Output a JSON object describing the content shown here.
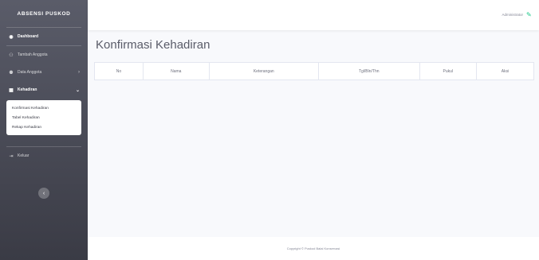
{
  "app": {
    "brand": "ABSENSI PUSKOD"
  },
  "sidebar": {
    "items": [
      {
        "label": "Dashboard",
        "icon": "tachometer-icon"
      },
      {
        "label": "Tambah Anggota",
        "icon": "user-plus-icon"
      },
      {
        "label": "Data Anggota",
        "icon": "users-icon"
      },
      {
        "label": "Kehadiran",
        "icon": "table-icon"
      },
      {
        "label": "Keluar",
        "icon": "sign-out-icon"
      }
    ],
    "submenu": [
      "Konfirmasi Kehadiran",
      "Tabel Kehadiran",
      "Rekap Kehadiran"
    ]
  },
  "topbar": {
    "user_name": "Administrator"
  },
  "main": {
    "title": "Konfirmasi Kehadiran",
    "table": {
      "columns": [
        "No",
        "Nama",
        "Keterangan",
        "Tgl/Bln/Thn",
        "Pukul",
        "Aksi"
      ],
      "rows": []
    }
  },
  "footer": {
    "text": "Copyright © Puskod Balai Konservasi"
  },
  "colors": {
    "sidebar_top": "#5a5c69",
    "sidebar_bottom": "#3a3b45",
    "accent": "#1cc88a"
  }
}
